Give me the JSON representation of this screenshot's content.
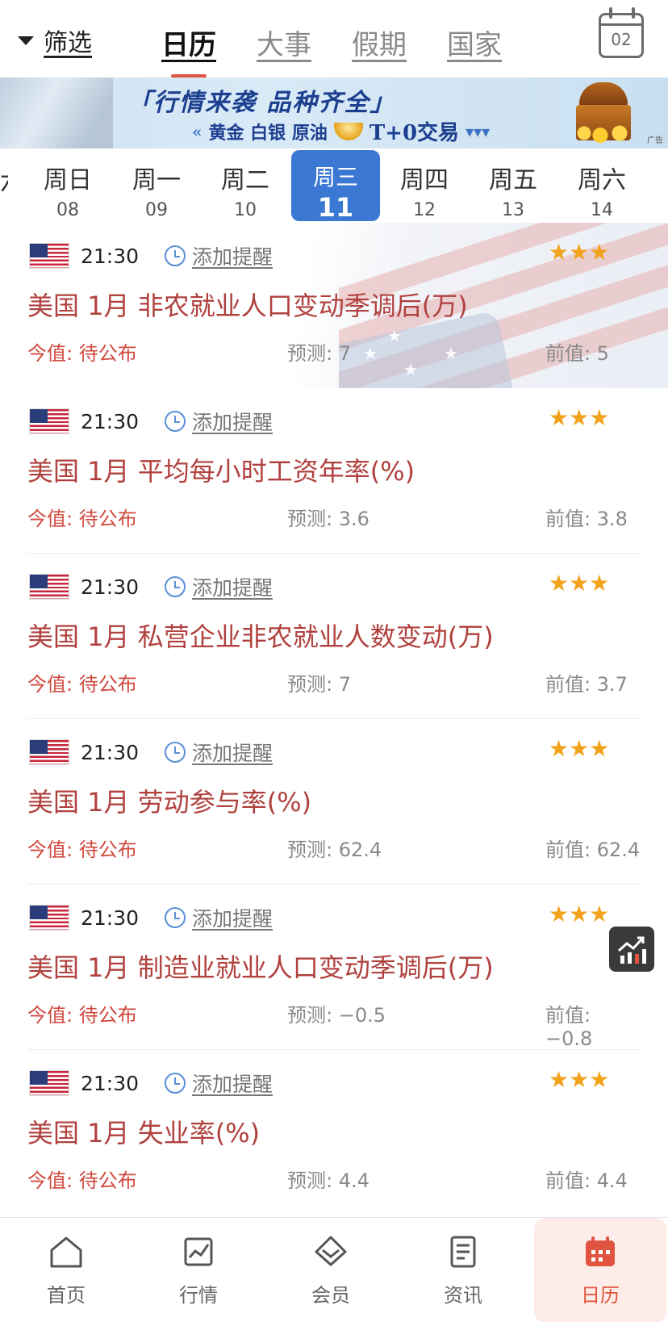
{
  "header": {
    "filter_label": "筛选",
    "tabs": [
      {
        "label": "日历",
        "active": true
      },
      {
        "label": "大事",
        "active": false
      },
      {
        "label": "假期",
        "active": false
      },
      {
        "label": "国家",
        "active": false
      }
    ],
    "calendar_button_date": "02"
  },
  "banner": {
    "headline": "「行情来袭 品种齐全」",
    "sub_left": "«",
    "products": "黄金 白银 原油",
    "trade": "T+0交易",
    "sub_right": "▾▾▾",
    "ad_tag": "广告"
  },
  "week": {
    "days": [
      {
        "weekday": "周日",
        "date": "08"
      },
      {
        "weekday": "周一",
        "date": "09"
      },
      {
        "weekday": "周二",
        "date": "10"
      },
      {
        "weekday": "周三",
        "date": "11",
        "selected": true
      },
      {
        "weekday": "周四",
        "date": "12"
      },
      {
        "weekday": "周五",
        "date": "13"
      },
      {
        "weekday": "周六",
        "date": "14"
      }
    ]
  },
  "events": [
    {
      "time": "21:30",
      "remind": "添加提醒",
      "stars": "★★★",
      "title": "美国 1月 非农就业人口变动季调后(万)",
      "actual": "今值: 待公布",
      "forecast": "预测: 7",
      "previous": "前值: 5",
      "country_icon": "us-flag-icon"
    },
    {
      "time": "21:30",
      "remind": "添加提醒",
      "stars": "★★★",
      "title": "美国 1月 平均每小时工资年率(%)",
      "actual": "今值: 待公布",
      "forecast": "预测: 3.6",
      "previous": "前值: 3.8",
      "country_icon": "us-flag-icon"
    },
    {
      "time": "21:30",
      "remind": "添加提醒",
      "stars": "★★★",
      "title": "美国 1月 私营企业非农就业人数变动(万)",
      "actual": "今值: 待公布",
      "forecast": "预测: 7",
      "previous": "前值: 3.7",
      "country_icon": "us-flag-icon"
    },
    {
      "time": "21:30",
      "remind": "添加提醒",
      "stars": "★★★",
      "title": "美国 1月 劳动参与率(%)",
      "actual": "今值: 待公布",
      "forecast": "预测: 62.4",
      "previous": "前值: 62.4",
      "country_icon": "us-flag-icon"
    },
    {
      "time": "21:30",
      "remind": "添加提醒",
      "stars": "★★★",
      "title": "美国 1月 制造业就业人口变动季调后(万)",
      "actual": "今值: 待公布",
      "forecast": "预测: −0.5",
      "previous": "前值: −0.8",
      "country_icon": "us-flag-icon"
    },
    {
      "time": "21:30",
      "remind": "添加提醒",
      "stars": "★★★",
      "title": "美国 1月 失业率(%)",
      "actual": "今值: 待公布",
      "forecast": "预测: 4.4",
      "previous": "前值: 4.4",
      "country_icon": "us-flag-icon"
    }
  ],
  "nav": {
    "items": [
      {
        "label": "首页",
        "icon": "home-icon"
      },
      {
        "label": "行情",
        "icon": "market-chart-icon"
      },
      {
        "label": "会员",
        "icon": "diamond-icon"
      },
      {
        "label": "资讯",
        "icon": "news-icon"
      },
      {
        "label": "日历",
        "icon": "calendar-icon",
        "active": true
      }
    ]
  },
  "colors": {
    "accent": "#e0533f",
    "selected_day": "#3a78d4",
    "title_red": "#b0413e",
    "star": "#f2a21b"
  }
}
